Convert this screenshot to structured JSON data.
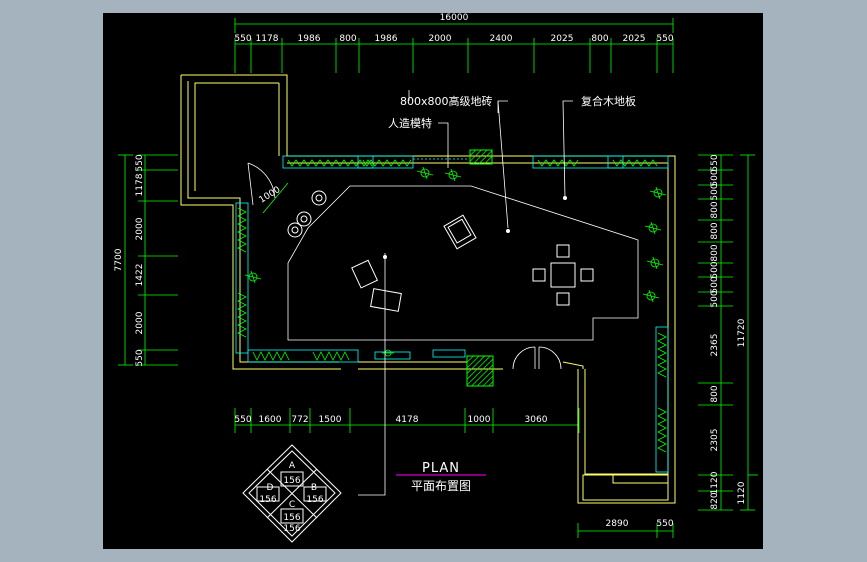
{
  "colors": {
    "background": "#a5b3bf",
    "canvas": "#000000",
    "wall": "#ffff66",
    "dimension": "#00ff00",
    "fixture": "#00ffff",
    "text": "#ffffff",
    "accent": "#ff00ff"
  },
  "top_dims": {
    "overall": "16000",
    "segments": [
      "550",
      "1178",
      "1986",
      "800",
      "1986",
      "2000",
      "2400",
      "2025",
      "800",
      "2025",
      "550"
    ]
  },
  "bottom_dims": {
    "segments": [
      "550",
      "1600",
      "772",
      "1500",
      "4178",
      "1000",
      "3060"
    ]
  },
  "lower_right_dims": {
    "segments": [
      "2890",
      "550"
    ]
  },
  "left_dims": {
    "overall": "7700",
    "segments": [
      "550",
      "1178",
      "2000",
      "1422",
      "2000",
      "550"
    ]
  },
  "right_dims": {
    "overall": "11720",
    "segments": [
      "550",
      "500",
      "500",
      "800",
      "800",
      "800",
      "500",
      "500",
      "500",
      "2365",
      "800",
      "2305",
      "1120",
      "820"
    ],
    "outer_bottom": "1120"
  },
  "door_dim": "1000",
  "labels": {
    "floor_tile": "800x800高级地砖",
    "mannequin": "人造模特",
    "wood_floor": "复合木地板"
  },
  "plan_title": "PLAN",
  "plan_subtitle": "平面布置图",
  "legend": {
    "a": "A",
    "b": "B",
    "c": "C",
    "d": "D",
    "v1": "156",
    "v2": "156",
    "v3": "156",
    "v4": "156",
    "v5": "156"
  }
}
